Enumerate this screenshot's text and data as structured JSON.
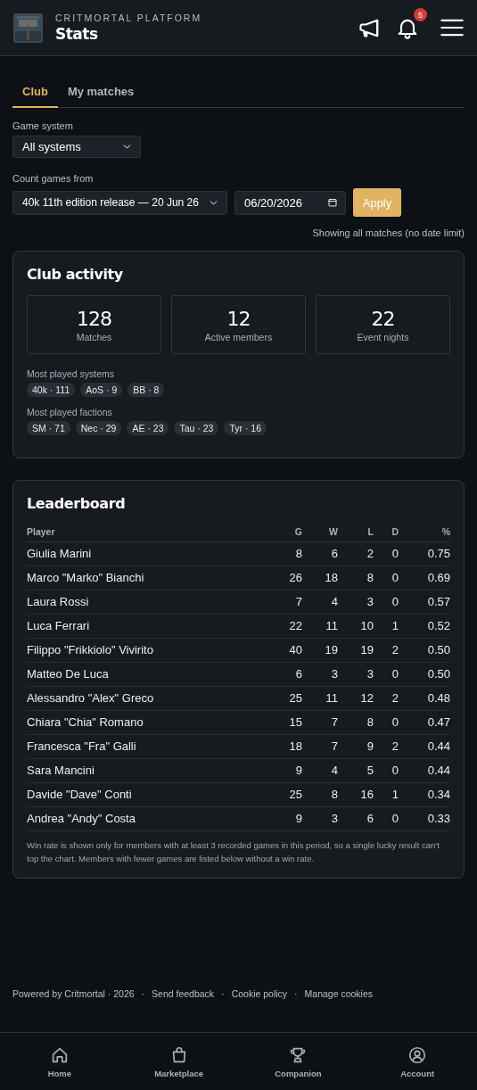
{
  "header": {
    "overline": "CRITMORTAL PLATFORM",
    "title": "Stats",
    "notification_count": "5"
  },
  "tabs": [
    {
      "label": "Club",
      "selected": true
    },
    {
      "label": "My matches",
      "selected": false
    }
  ],
  "filters": {
    "system_label": "Game system",
    "system_value": "All systems",
    "from_label": "Count games from",
    "from_value": "40k 11th edition release — 20 Jun 26",
    "date_value": "06/20/2026",
    "apply": "Apply",
    "note": "Showing all matches (no date limit)"
  },
  "club_activity": {
    "title": "Club activity",
    "stats": [
      {
        "value": "128",
        "label": "Matches"
      },
      {
        "value": "12",
        "label": "Active members"
      },
      {
        "value": "22",
        "label": "Event nights"
      }
    ],
    "groups": [
      {
        "label": "Most played systems",
        "chips": [
          "40k · 111",
          "AoS · 9",
          "BB · 8"
        ]
      },
      {
        "label": "Most played factions",
        "chips": [
          "SM · 71",
          "Nec · 29",
          "AE · 23",
          "Tau · 23",
          "Tyr · 16"
        ]
      }
    ]
  },
  "leaderboard": {
    "title": "Leaderboard",
    "columns": [
      "Player",
      "G",
      "W",
      "L",
      "D",
      "%"
    ],
    "rows": [
      [
        "Giulia Marini",
        "8",
        "6",
        "2",
        "0",
        "0.75"
      ],
      [
        "Marco \"Marko\" Bianchi",
        "26",
        "18",
        "8",
        "0",
        "0.69"
      ],
      [
        "Laura Rossi",
        "7",
        "4",
        "3",
        "0",
        "0.57"
      ],
      [
        "Luca Ferrari",
        "22",
        "11",
        "10",
        "1",
        "0.52"
      ],
      [
        "Filippo \"Frikkiolo\" Vivirito",
        "40",
        "19",
        "19",
        "2",
        "0.50"
      ],
      [
        "Matteo De Luca",
        "6",
        "3",
        "3",
        "0",
        "0.50"
      ],
      [
        "Alessandro \"Alex\" Greco",
        "25",
        "11",
        "12",
        "2",
        "0.48"
      ],
      [
        "Chiara \"Chia\" Romano",
        "15",
        "7",
        "8",
        "0",
        "0.47"
      ],
      [
        "Francesca \"Fra\" Galli",
        "18",
        "7",
        "9",
        "2",
        "0.44"
      ],
      [
        "Sara Mancini",
        "9",
        "4",
        "5",
        "0",
        "0.44"
      ],
      [
        "Davide \"Dave\" Conti",
        "25",
        "8",
        "16",
        "1",
        "0.34"
      ],
      [
        "Andrea \"Andy\" Costa",
        "9",
        "3",
        "6",
        "0",
        "0.33"
      ]
    ],
    "footnote": "Win rate is shown only for members with at least 3 recorded games in this period, so a single lucky result can't top the chart. Members with fewer games are listed below without a win rate."
  },
  "footer": {
    "credit": "Powered by Critmortal · 2026",
    "separator": "·",
    "links": [
      "Send feedback",
      "Cookie policy",
      "Manage cookies"
    ]
  },
  "bottom_nav": [
    {
      "label": "Home"
    },
    {
      "label": "Marketplace"
    },
    {
      "label": "Companion"
    },
    {
      "label": "Account"
    }
  ]
}
